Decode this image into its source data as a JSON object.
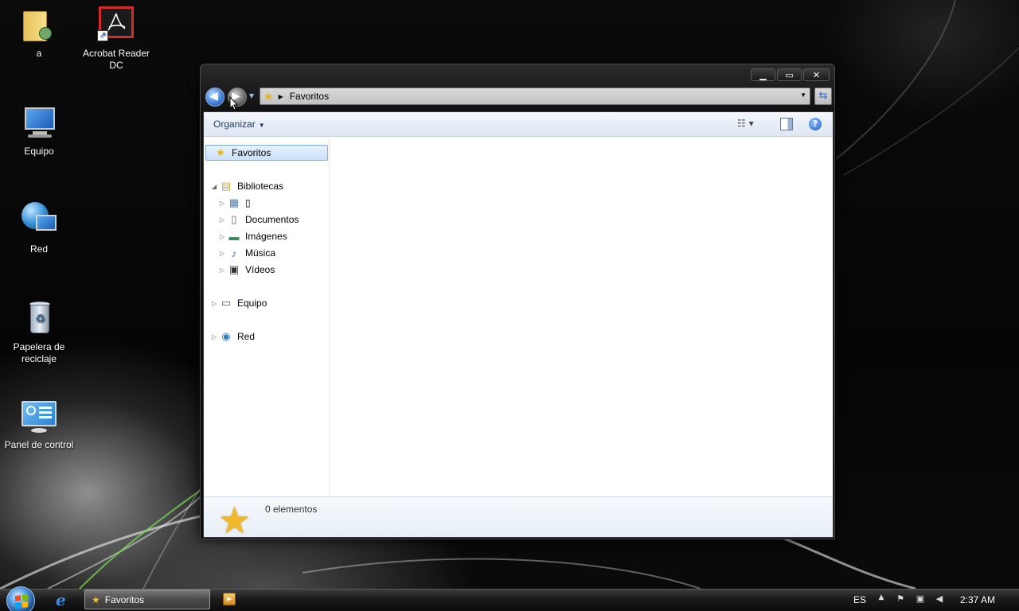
{
  "desktop": {
    "icons": [
      {
        "label": "a",
        "icon": "user-folder-icon"
      },
      {
        "label": "Acrobat Reader DC",
        "icon": "acrobat-reader-icon"
      },
      {
        "label": "Equipo",
        "icon": "computer-icon"
      },
      {
        "label": "Red",
        "icon": "network-icon"
      },
      {
        "label": "Papelera de reciclaje",
        "icon": "recycle-bin-icon"
      },
      {
        "label": "Panel de control",
        "icon": "control-panel-icon"
      }
    ]
  },
  "window": {
    "address": "Favoritos",
    "caption": {
      "minimize": "▁",
      "maximize": "▭",
      "close": "✕"
    },
    "command_bar": {
      "organize": "Organizar",
      "help": "?"
    },
    "nav_pane": {
      "favorites": "Favoritos",
      "libraries": "Bibliotecas",
      "library_items": [
        "▯",
        "Documentos",
        "Imágenes",
        "Música",
        "Vídeos"
      ],
      "computer": "Equipo",
      "network": "Red"
    },
    "details": {
      "count": "0 elementos"
    }
  },
  "taskbar": {
    "task_label": "Favoritos",
    "language": "ES",
    "clock": "2:37 AM",
    "accent_color": "#3d7cd6"
  }
}
